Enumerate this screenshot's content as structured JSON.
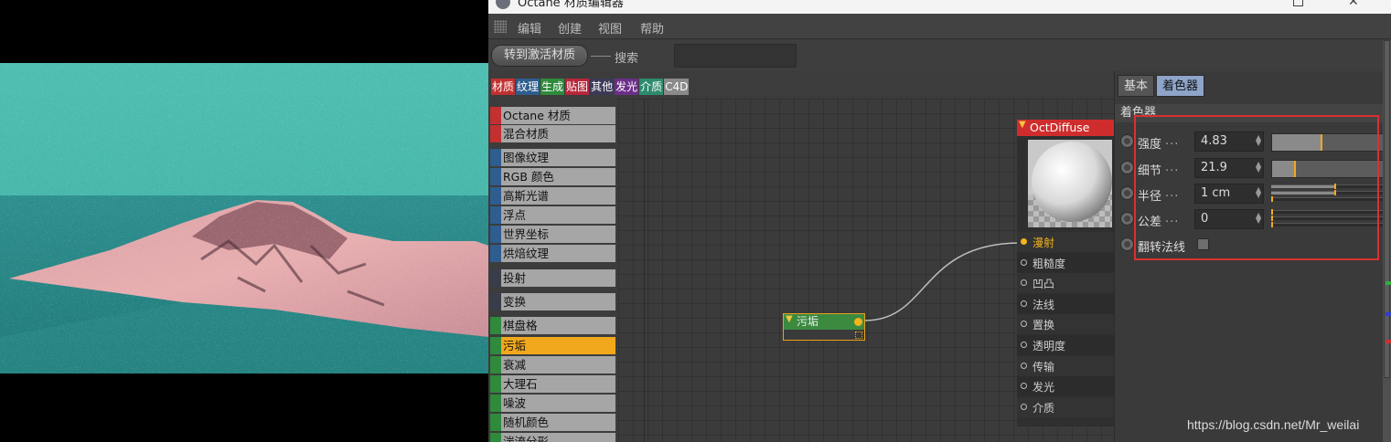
{
  "window": {
    "title": "Octane 材质编辑器"
  },
  "menu": [
    "编辑",
    "创建",
    "视图",
    "帮助"
  ],
  "toolbar": {
    "assign_label": "转到激活材质",
    "search_label": "搜索",
    "search_value": ""
  },
  "category_tabs": [
    {
      "label": "材质",
      "color": "#c2302f"
    },
    {
      "label": "纹理",
      "color": "#2e5d8f"
    },
    {
      "label": "生成",
      "color": "#2f8a3c"
    },
    {
      "label": "贴图",
      "color": "#b8263a"
    },
    {
      "label": "其他",
      "color": "#3a3a58"
    },
    {
      "label": "发光",
      "color": "#6b2f8a"
    },
    {
      "label": "介质",
      "color": "#2f8a6e"
    },
    {
      "label": "C4D",
      "color": "#8a8a8a"
    }
  ],
  "node_list": [
    {
      "label": "Octane 材质",
      "color": "#c2302f"
    },
    {
      "label": "混合材质",
      "color": "#c2302f"
    },
    {
      "label": "图像纹理",
      "color": "#2e5d8f"
    },
    {
      "label": "RGB 颜色",
      "color": "#2e5d8f"
    },
    {
      "label": "高斯光谱",
      "color": "#2e5d8f"
    },
    {
      "label": "浮点",
      "color": "#2e5d8f"
    },
    {
      "label": "世界坐标",
      "color": "#2e5d8f"
    },
    {
      "label": "烘焙纹理",
      "color": "#2e5d8f"
    },
    {
      "label": "投射",
      "color": "#383d4a"
    },
    {
      "label": "变换",
      "color": "#383d4a"
    },
    {
      "label": "棋盘格",
      "color": "#2f8a3c"
    },
    {
      "label": "污垢",
      "color": "#2f8a3c",
      "selected": true
    },
    {
      "label": "衰减",
      "color": "#2f8a3c"
    },
    {
      "label": "大理石",
      "color": "#2f8a3c"
    },
    {
      "label": "噪波",
      "color": "#2f8a3c"
    },
    {
      "label": "随机颜色",
      "color": "#2f8a3c"
    },
    {
      "label": "湍流分形",
      "color": "#2f8a3c"
    }
  ],
  "graph": {
    "dirt_node": {
      "title": "污垢"
    },
    "diffuse_node": {
      "title": "OctDiffuse",
      "ports": [
        "漫射",
        "粗糙度",
        "凹凸",
        "法线",
        "置换",
        "透明度",
        "传输",
        "发光",
        "介质"
      ],
      "active_port": "漫射"
    }
  },
  "attributes": {
    "tabs": [
      "基本",
      "着色器"
    ],
    "active_tab": "着色器",
    "section": "着色器",
    "params": [
      {
        "label": "强度",
        "dots": "...",
        "value": "4.83",
        "slider_fraction": 0.4
      },
      {
        "label": "细节",
        "dots": "...",
        "value": "21.9",
        "slider_fraction": 0.18
      },
      {
        "label": "半径",
        "dots": "...",
        "value": "1 cm",
        "slider_fraction": 0.52
      },
      {
        "label": "公差",
        "dots": "...",
        "value": "0",
        "slider_fraction": 0.0
      }
    ],
    "flip_normals": {
      "label": "翻转法线",
      "checked": false
    }
  },
  "watermark": "https://blog.csdn.net/Mr_weilai",
  "colors": {
    "accent": "#f2a81c",
    "highlight_box": "#d93030",
    "selected_tab": "#8ea4c8"
  }
}
